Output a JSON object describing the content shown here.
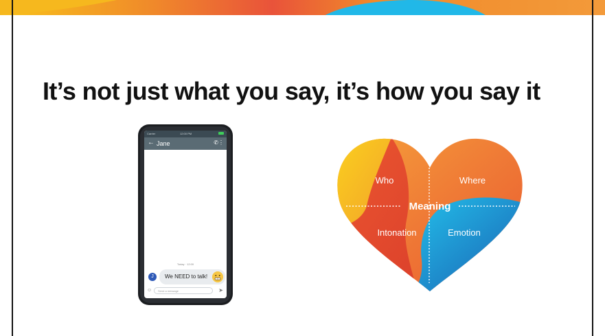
{
  "slide": {
    "title": "It’s not just what you say, it’s how you say it"
  },
  "phone": {
    "status_left": "Carrier",
    "status_time": "12:00 PM",
    "contact_name": "Jane",
    "back_glyph": "←",
    "call_glyph": "✆",
    "more_glyph": "⋮",
    "date_stamp": "Today · 12:00",
    "avatar_letter": "J",
    "message": "We NEED to talk!",
    "compose_placeholder": "Send a message",
    "send_glyph": "➤",
    "attach_glyph": "☺"
  },
  "heart": {
    "center_label": "Meaning",
    "quadrants": {
      "top_left": "Who",
      "top_right": "Where",
      "bottom_left": "Intonation",
      "bottom_right": "Emotion"
    }
  },
  "colors": {
    "accent_orange": "#f07f3c",
    "accent_red": "#e8452e",
    "accent_yellow": "#f5c21b",
    "accent_cyan": "#1fb9e6",
    "accent_blue": "#1a66b7",
    "frame": "#111111"
  }
}
